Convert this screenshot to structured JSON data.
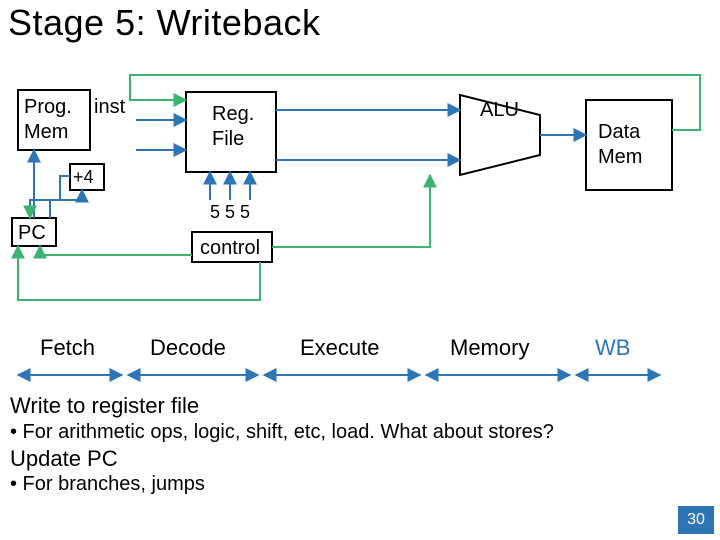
{
  "title": "Stage 5: Writeback",
  "blocks": {
    "progmem_l1": "Prog.",
    "progmem_l2": "Mem",
    "inst": "inst",
    "plus4": "+4",
    "pc": "PC",
    "regfile_l1": "Reg.",
    "regfile_l2": "File",
    "control": "control",
    "bits": "5 5 5",
    "alu": "ALU",
    "datamem_l1": "Data",
    "datamem_l2": "Mem"
  },
  "stages": {
    "fetch": "Fetch",
    "decode": "Decode",
    "execute": "Execute",
    "memory": "Memory",
    "wb": "WB"
  },
  "text": {
    "h1": "Write to register file",
    "b1": "•   For arithmetic ops, logic, shift, etc, load.  What about stores?",
    "h2": "Update PC",
    "b2": "•   For branches, jumps"
  },
  "page": "30",
  "colors": {
    "blue": "#2e75b6",
    "green": "#3cb371",
    "accent": "#2e75b6"
  }
}
